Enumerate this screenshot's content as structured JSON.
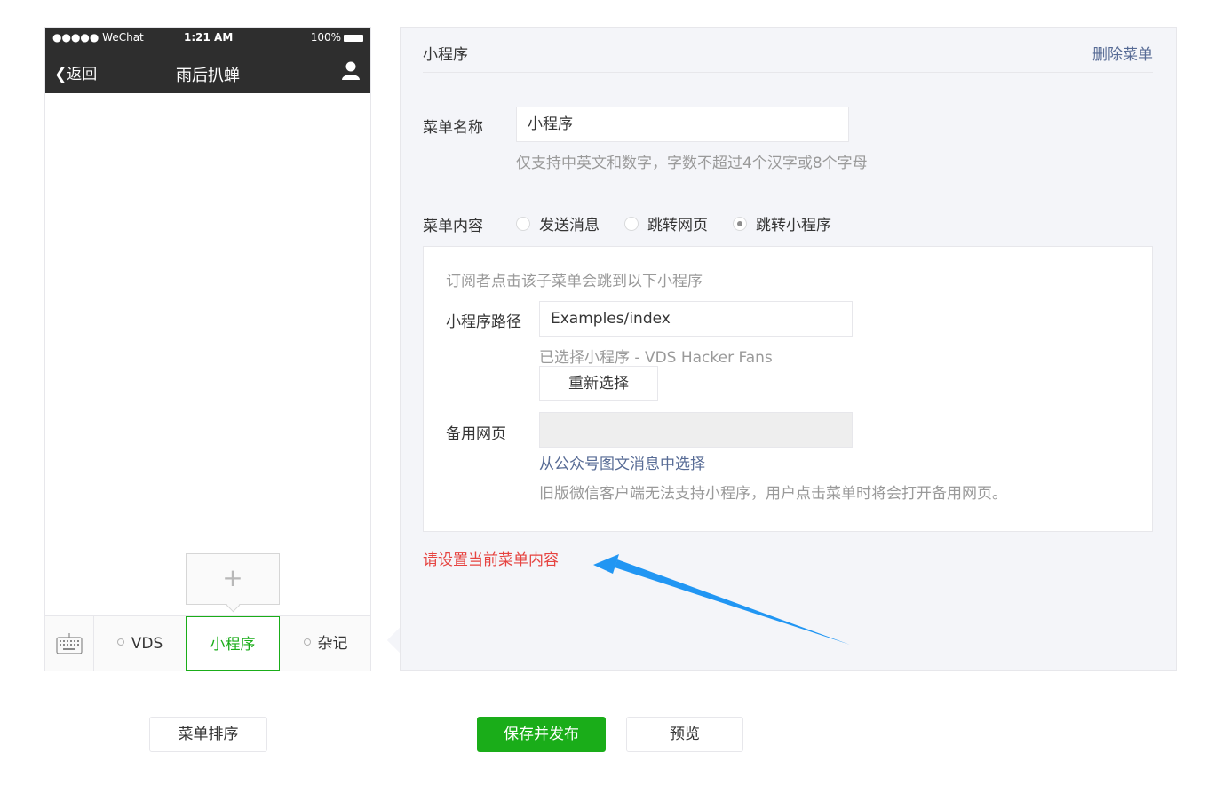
{
  "phone": {
    "carrier": "●●●●● WeChat",
    "time": "1:21 AM",
    "battery": "100%",
    "back_label": "返回",
    "account_name": "雨后扒蝉",
    "popup_add": "+",
    "menu_items": [
      {
        "label": "VDS"
      },
      {
        "label": "小程序"
      },
      {
        "label": "杂记"
      }
    ]
  },
  "editor": {
    "title": "小程序",
    "delete_label": "删除菜单",
    "name_label": "菜单名称",
    "name_value": "小程序",
    "name_hint": "仅支持中英文和数字，字数不超过4个汉字或8个字母",
    "content_label": "菜单内容",
    "content_options": [
      {
        "label": "发送消息",
        "selected": false
      },
      {
        "label": "跳转网页",
        "selected": false
      },
      {
        "label": "跳转小程序",
        "selected": true
      }
    ],
    "miniapp": {
      "intro": "订阅者点击该子菜单会跳到以下小程序",
      "path_label": "小程序路径",
      "path_value": "Examples/index",
      "selected_app": "已选择小程序 - VDS Hacker Fans",
      "reselect_label": "重新选择",
      "backup_label": "备用网页",
      "backup_value": "",
      "choose_link": "从公众号图文消息中选择",
      "backup_hint": "旧版微信客户端无法支持小程序，用户点击菜单时将会打开备用网页。"
    },
    "error_text": "请设置当前菜单内容"
  },
  "footer": {
    "sort_label": "菜单排序",
    "save_label": "保存并发布",
    "preview_label": "预览"
  },
  "colors": {
    "accent_green": "#1aad19",
    "link_blue": "#576b95",
    "error_red": "#e64340",
    "annotation_arrow": "#2196f3"
  }
}
